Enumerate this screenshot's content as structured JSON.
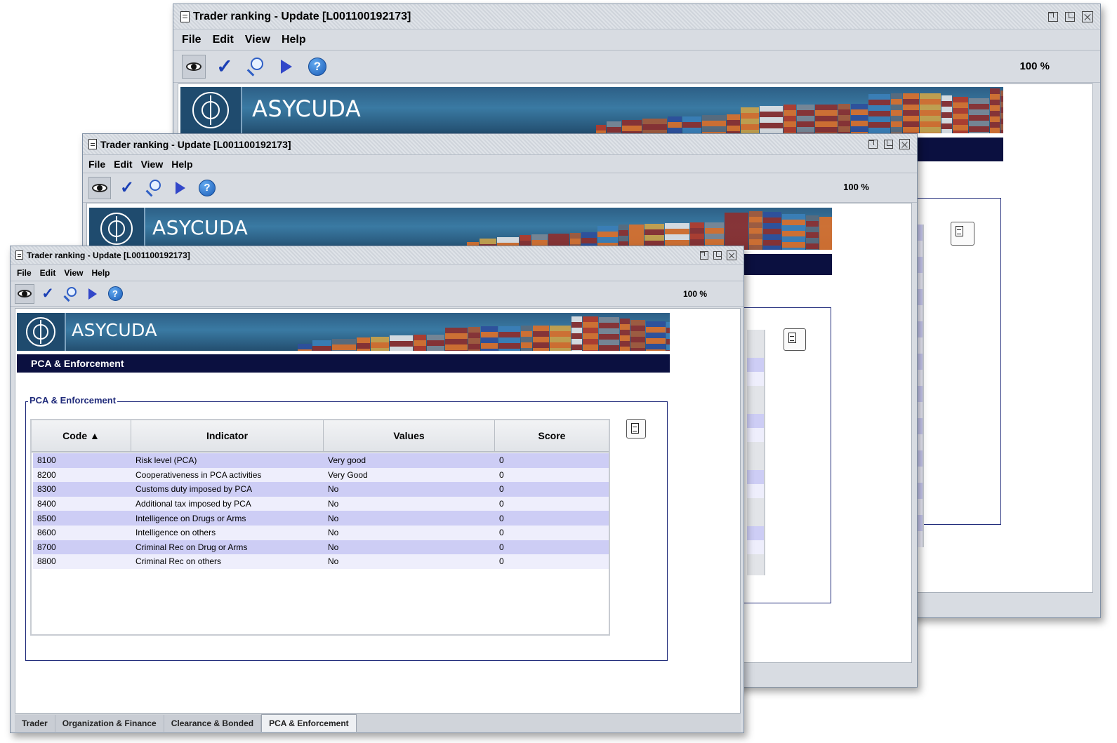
{
  "window": {
    "title": "Trader ranking - Update [L001100192173]",
    "menu": [
      "File",
      "Edit",
      "View",
      "Help"
    ],
    "zoom": "100 %",
    "toolbar_icons": [
      "eye-icon",
      "check-icon",
      "magnifier-icon",
      "play-icon",
      "help-icon"
    ],
    "help_glyph": "?",
    "check_glyph": "✓"
  },
  "banner": {
    "brand": "ASYCUDA"
  },
  "section": {
    "title": "PCA & Enforcement"
  },
  "group": {
    "legend": "PCA & Enforcement"
  },
  "table": {
    "columns": [
      "Code ▲",
      "Indicator",
      "Values",
      "Score"
    ],
    "rows": [
      {
        "code": "8100",
        "indicator": "Risk level (PCA)",
        "value": "Very good",
        "score": "0"
      },
      {
        "code": "8200",
        "indicator": "Cooperativeness in PCA activities",
        "value": "Very Good",
        "score": "0"
      },
      {
        "code": "8300",
        "indicator": "Customs duty imposed by PCA",
        "value": "No",
        "score": "0"
      },
      {
        "code": "8400",
        "indicator": "Additional tax imposed by PCA",
        "value": "No",
        "score": "0"
      },
      {
        "code": "8500",
        "indicator": "Intelligence on Drugs or Arms",
        "value": "No",
        "score": "0"
      },
      {
        "code": "8600",
        "indicator": "Intelligence on others",
        "value": "No",
        "score": "0"
      },
      {
        "code": "8700",
        "indicator": "Criminal Rec on Drug or Arms",
        "value": "No",
        "score": "0"
      },
      {
        "code": "8800",
        "indicator": "Criminal Rec on others",
        "value": "No",
        "score": "0"
      }
    ]
  },
  "tabs": [
    "Trader",
    "Organization & Finance",
    "Clearance & Bonded",
    "PCA & Enforcement"
  ],
  "active_tab": "PCA & Enforcement",
  "colors": {
    "section_bar": "#0b1040",
    "row_odd": "#cdcdf5",
    "row_even": "#eeeefc",
    "group_border": "#1f2a7a"
  }
}
